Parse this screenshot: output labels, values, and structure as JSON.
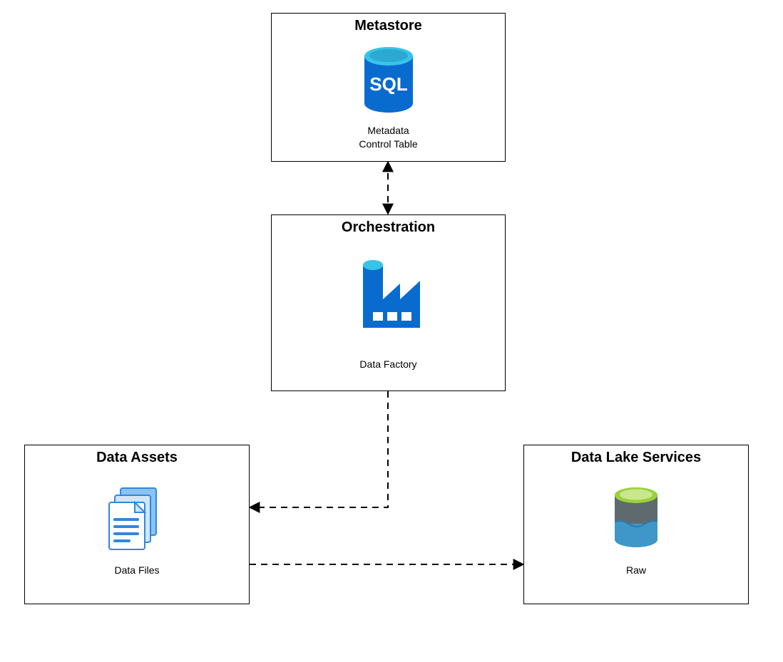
{
  "boxes": {
    "metastore": {
      "title": "Metastore",
      "caption_line1": "Metadata",
      "caption_line2": "Control Table",
      "sql_label": "SQL"
    },
    "orchestration": {
      "title": "Orchestration",
      "caption": "Data Factory"
    },
    "data_assets": {
      "title": "Data Assets",
      "caption": "Data Files"
    },
    "data_lake": {
      "title": "Data Lake Services",
      "caption": "Raw"
    }
  }
}
